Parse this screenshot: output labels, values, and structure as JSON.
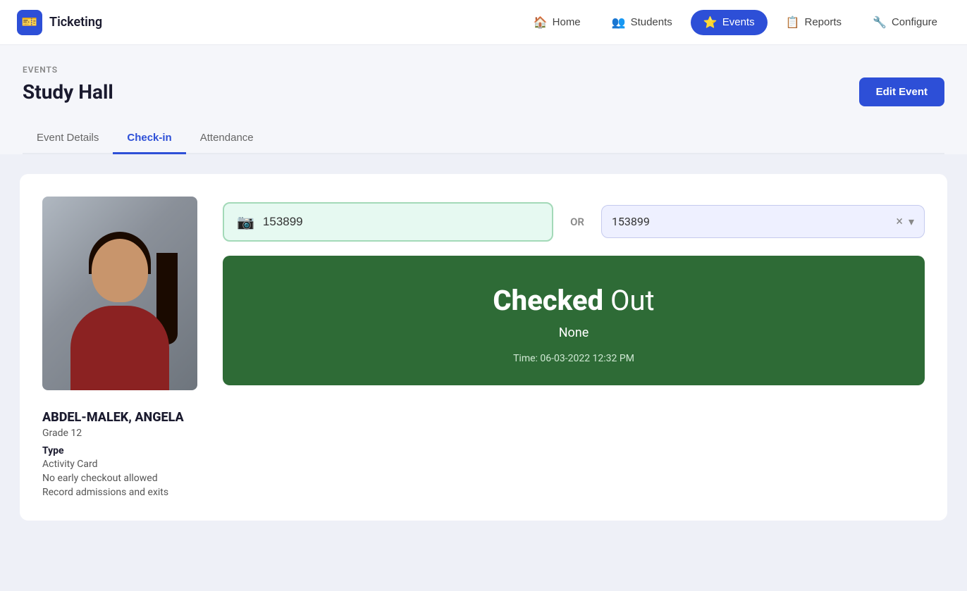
{
  "app": {
    "logo_text": "🎫",
    "title": "Ticketing"
  },
  "navbar": {
    "items": [
      {
        "id": "home",
        "label": "Home",
        "icon": "🏠",
        "active": false
      },
      {
        "id": "students",
        "label": "Students",
        "icon": "👥",
        "active": false
      },
      {
        "id": "events",
        "label": "Events",
        "icon": "⭐",
        "active": true
      },
      {
        "id": "reports",
        "label": "Reports",
        "icon": "📋",
        "active": false
      },
      {
        "id": "configure",
        "label": "Configure",
        "icon": "🔧",
        "active": false
      }
    ]
  },
  "breadcrumb": "EVENTS",
  "page": {
    "title": "Study Hall",
    "edit_button": "Edit Event"
  },
  "tabs": [
    {
      "id": "event-details",
      "label": "Event Details",
      "active": false
    },
    {
      "id": "check-in",
      "label": "Check-in",
      "active": true
    },
    {
      "id": "attendance",
      "label": "Attendance",
      "active": false
    }
  ],
  "checkin": {
    "scan_value": "153899",
    "scan_placeholder": "153899",
    "or_label": "OR",
    "select_value": "153899",
    "select_clear": "×",
    "select_arrow": "▾",
    "status": {
      "checked_label": "Checked",
      "out_label": "Out",
      "sub_label": "None",
      "time_label": "Time: 06-03-2022 12:32 PM"
    }
  },
  "student": {
    "name": "ABDEL-MALEK, ANGELA",
    "grade": "Grade 12",
    "type_label": "Type",
    "type_value": "Activity Card",
    "note1": "No early checkout allowed",
    "note2": "Record admissions and exits"
  }
}
